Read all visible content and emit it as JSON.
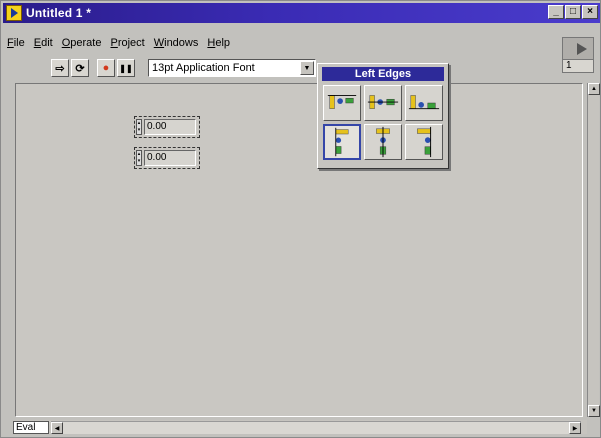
{
  "window": {
    "title": "Untitled 1 *",
    "buttons": {
      "minimize": "_",
      "maximize": "□",
      "close": "×"
    }
  },
  "menubar": {
    "items": [
      {
        "first": "F",
        "rest": "ile"
      },
      {
        "first": "E",
        "rest": "dit"
      },
      {
        "first": "O",
        "rest": "perate"
      },
      {
        "first": "P",
        "rest": "roject"
      },
      {
        "first": "W",
        "rest": "indows"
      },
      {
        "first": "H",
        "rest": "elp"
      }
    ]
  },
  "toolbar": {
    "run_icon": "⇨",
    "run_continuous_icon": "⟳",
    "abort_icon": "●",
    "pause_icon": "❚❚",
    "font_value": "13pt Application Font",
    "dropdown_icon": "▼"
  },
  "vi_icon": {
    "number": "1"
  },
  "controls": [
    {
      "value": "0.00"
    },
    {
      "value": "0.00"
    }
  ],
  "palette": {
    "title": "Left Edges",
    "selected_index": 3
  },
  "status": {
    "eval_label": "Eval"
  },
  "colors": {
    "titlebar": "#2a1c8a",
    "palette_title": "#2d2a99",
    "selection": "#3546a8"
  }
}
